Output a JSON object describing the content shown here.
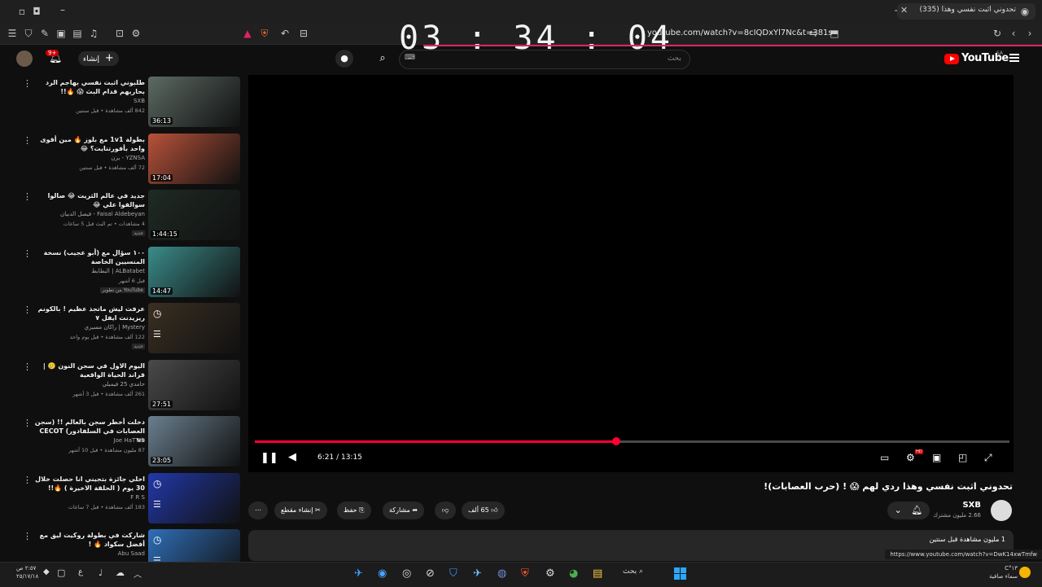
{
  "browser": {
    "tab_title": "(335) تحدوني اثبت نفسي وهذا",
    "url": "youtube.com/watch?v=8cIQDxYl7Nc&t=381s"
  },
  "overlay_clock": "03 : 34 : 04",
  "header": {
    "logo_text": "YouTube",
    "logo_region": "SA",
    "search_placeholder": "بحث",
    "create_label": "إنشاء",
    "notifications_badge": "9+"
  },
  "player": {
    "current_time": "6:21",
    "duration": "13:15",
    "time_display": "6:21 / 13:15",
    "progress": 0.479,
    "hd_badge": "HD"
  },
  "video": {
    "title": "تحدوني اثبت نفسي وهذا ردي لهم 😱 ! (حرب العصابات)!",
    "channel": "SXB",
    "subscribers": "2.66 مليون مشترك",
    "likes": "65 ألف",
    "share_label": "مشاركة",
    "save_label": "حفظ",
    "clip_label": "إنشاء مقطع",
    "description_preview": "1 مليون مشاهدة  قبل سنتين"
  },
  "status_url": "https://www.youtube.com/watch?v=DwK14xwTmfw",
  "recommendations": [
    {
      "title": "طلبوني اثبت نفسي بهاجم الرد بحاربهم قدام البث 😱 🔥!!",
      "channel": "SXB",
      "meta": "842 ألف مشاهدة • قبل سنتين",
      "duration": "36:13",
      "badge": "",
      "color": "#5c6a63"
    },
    {
      "title": "بطولة 1v1 مع بلوز 🔥 مين أقوى واحد بأفورتنايت؟ 😂",
      "channel": "YZNSA - يزن",
      "meta": "72 ألف مشاهدة • قبل سنتين",
      "duration": "17:04",
      "badge": "",
      "color": "#b8523a"
    },
    {
      "title": "جديد في عالم الثريت 😂 صالوا سوالفوا علي 😂",
      "channel": "Faisal Aldebeyan - فيصل الدبيان",
      "meta": "4 مشاهدات • تم البث قبل 5 ساعات",
      "duration": "1:44:15",
      "badge": "جديد",
      "color": "#1f2b24"
    },
    {
      "title": "١٠٠ سؤال مع (أبو عجيب) نسخة المنسيين الخاصة",
      "channel": "ALBatabet | البطابط",
      "meta": "قبل 6 أشهر",
      "duration": "14:47",
      "badge": "من تطوير YouTube",
      "color": "#3a8c8a"
    },
    {
      "title": "عرفت ليش ماتجذ عظيم ! بالكونم ريزيدنت ايفل ٧",
      "channel": "Mystery | راكان مسيري",
      "meta": "122 ألف مشاهدة • قبل يوم واحد",
      "duration": "",
      "badge": "جديد",
      "color": "#3a2f22"
    },
    {
      "title": "اليوم الاول في سجن النون 🥲 | قراند الحياة الواقعية",
      "channel": "حامدي 25 فيمبلي",
      "meta": "261 ألف مشاهدة • قبل 3 أشهر",
      "duration": "27:51",
      "badge": "",
      "color": "#4a4a4a"
    },
    {
      "title": "دخلت أخطر سجن بالعالم !! (سجن العصابات في السلفادور) CECOT vs",
      "channel": "Joe HaTTab",
      "meta": "87 مليون مشاهدة • قبل 10 أشهر",
      "duration": "23:05",
      "badge": "",
      "color": "#6b7f8f"
    },
    {
      "title": "اخلي جائزة بتجيني انا حصلت خلال 30 يوم ( الحلقة الاخيرة ) 🔥!!",
      "channel": "F R S",
      "meta": "183 ألف مشاهدة • قبل 7 ساعات",
      "duration": "",
      "badge": "",
      "color": "#2238a8"
    },
    {
      "title": "شاركت في بطولة روكيت ليق مع أفضل سكواد 🔥 !",
      "channel": "Abu Saad",
      "meta": "",
      "duration": "",
      "badge": "",
      "color": "#2f6fb8"
    }
  ],
  "taskbar": {
    "search_label": "بحث",
    "time": "٢:٥٧ ص",
    "date": "٢٥/١٧/١٨",
    "temperature": "١٣°C",
    "weather": "سماء صافية"
  },
  "colors": {
    "accent": "#ff0033",
    "background": "#0f0f0f",
    "chip": "#272727"
  }
}
